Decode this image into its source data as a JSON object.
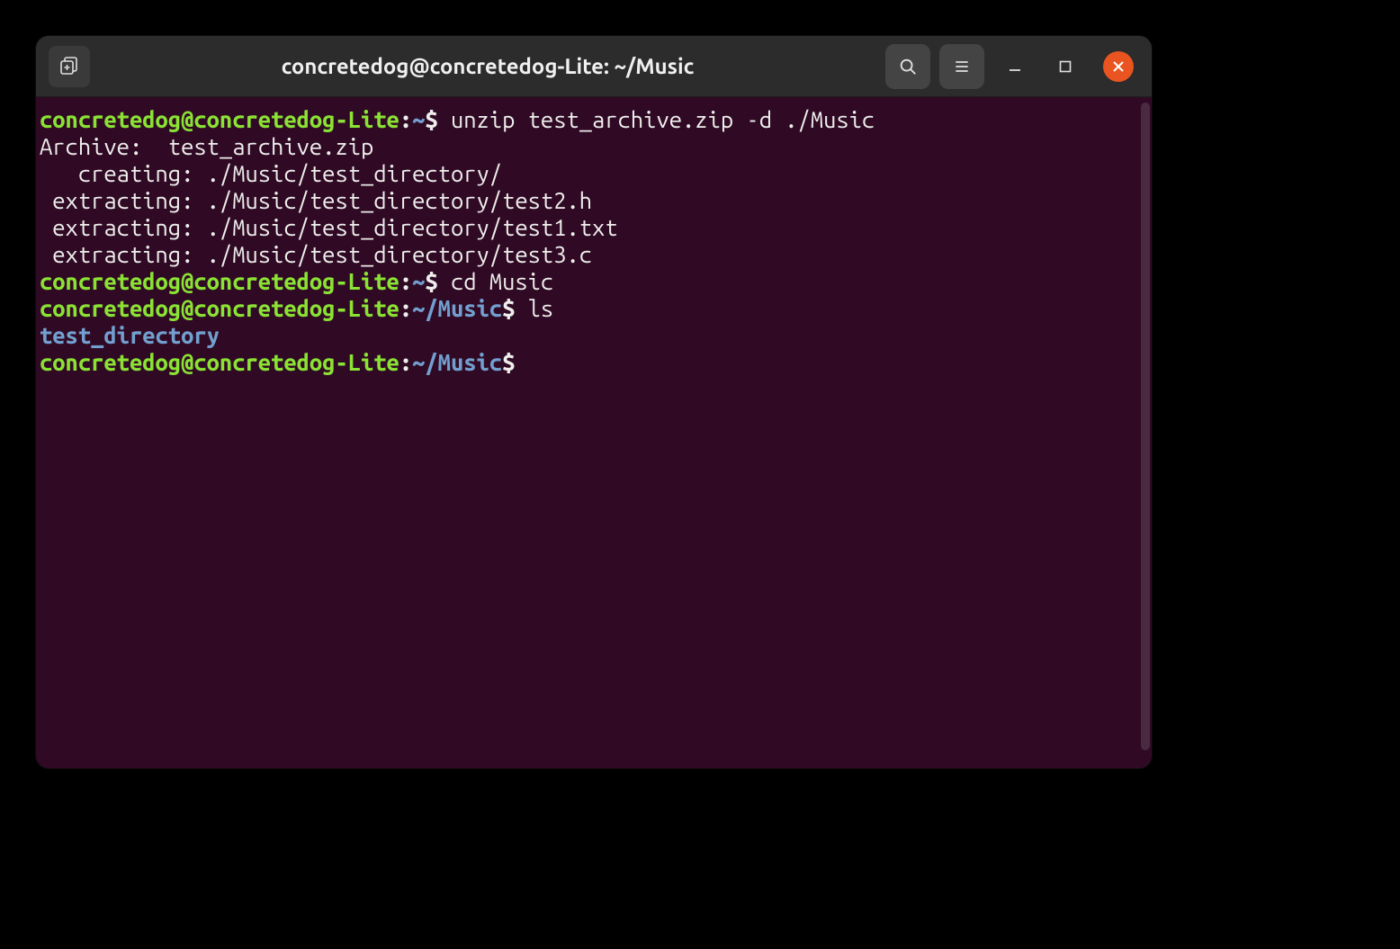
{
  "window": {
    "title": "concretedog@concretedog-Lite: ~/Music"
  },
  "prompts": [
    {
      "user_host": "concretedog@concretedog-Lite",
      "colon": ":",
      "path": "~",
      "dollar": "$ ",
      "command": "unzip test_archive.zip -d ./Music"
    },
    {
      "user_host": "concretedog@concretedog-Lite",
      "colon": ":",
      "path": "~",
      "dollar": "$ ",
      "command": "cd Music"
    },
    {
      "user_host": "concretedog@concretedog-Lite",
      "colon": ":",
      "path": "~/Music",
      "dollar": "$ ",
      "command": "ls"
    },
    {
      "user_host": "concretedog@concretedog-Lite",
      "colon": ":",
      "path": "~/Music",
      "dollar": "$ ",
      "command": ""
    }
  ],
  "output": {
    "archive_line": "Archive:  test_archive.zip",
    "lines": [
      "   creating: ./Music/test_directory/",
      " extracting: ./Music/test_directory/test2.h",
      " extracting: ./Music/test_directory/test1.txt",
      " extracting: ./Music/test_directory/test3.c"
    ],
    "ls_result": "test_directory"
  }
}
